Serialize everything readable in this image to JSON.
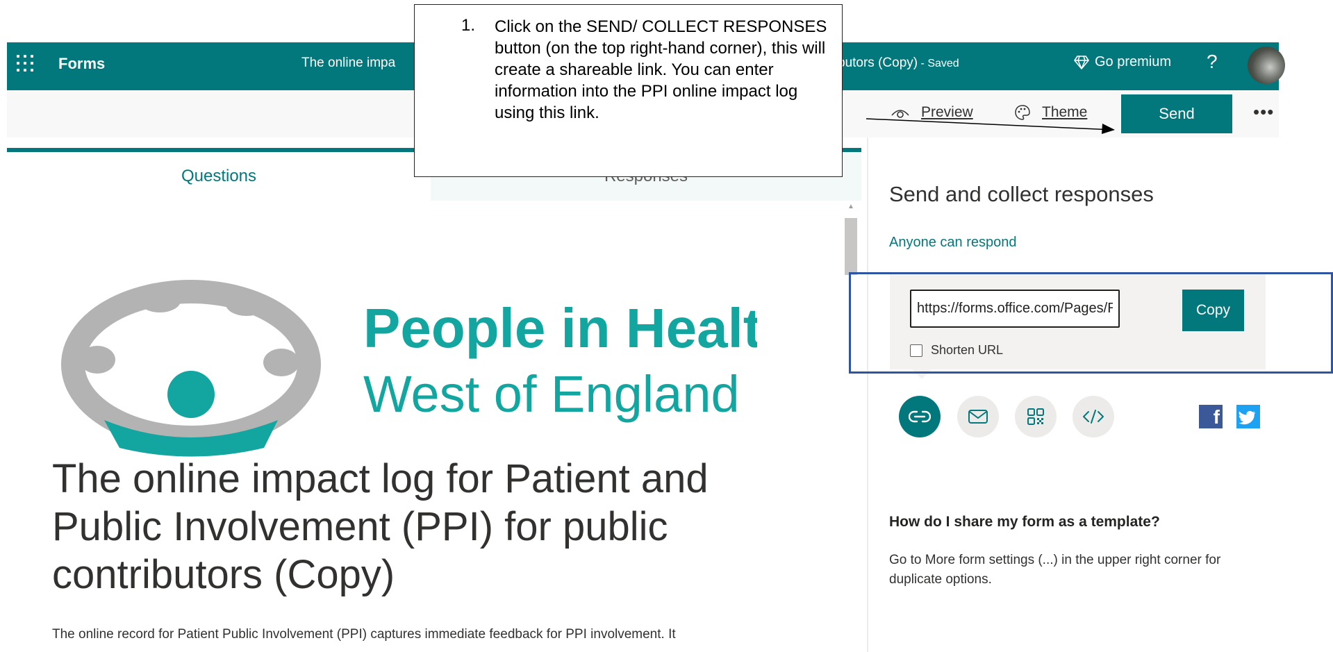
{
  "header": {
    "app_name": "Forms",
    "title_left": "The online impa",
    "title_right": "butors (Copy)",
    "saved": " - Saved",
    "premium_label": "Go premium",
    "help_label": "?"
  },
  "commandbar": {
    "preview_label": "Preview",
    "theme_label": "Theme",
    "send_label": "Send",
    "more_label": "•••"
  },
  "tabs": {
    "questions": "Questions",
    "responses": "Responses"
  },
  "logo": {
    "line1": "People in Health",
    "line2": "West of England"
  },
  "form": {
    "title": "The online impact log for Patient and Public Involvement (PPI) for public contributors (Copy)",
    "description": "The online record for Patient Public Involvement (PPI) captures immediate feedback for PPI involvement. It"
  },
  "send_panel": {
    "heading": "Send and collect responses",
    "audience": "Anyone can respond",
    "url": "https://forms.office.com/Pages/ResponsePage.aspx",
    "copy_label": "Copy",
    "shorten_label": "Shorten URL",
    "faq_question": "How do I share my form as a template?",
    "faq_answer": "Go to More form settings (...) in the upper right corner for duplicate options."
  },
  "annotation": {
    "step_number": "1.",
    "text": "Click on the SEND/ COLLECT RESPONSES button (on the top right-hand corner), this will create a shareable link. You can enter information into the PPI online impact log using this link."
  },
  "colors": {
    "brand_teal": "#03787c",
    "highlight_blue": "#2e55a4",
    "facebook": "#3b5998",
    "twitter": "#1da1f2"
  },
  "icons": {
    "waffle": "app-launcher-icon",
    "premium": "diamond-icon",
    "preview": "eye-icon",
    "theme": "palette-icon",
    "link": "link-icon",
    "mail": "mail-icon",
    "qr": "qr-code-icon",
    "embed": "embed-code-icon",
    "facebook": "facebook-icon",
    "twitter": "twitter-icon"
  }
}
